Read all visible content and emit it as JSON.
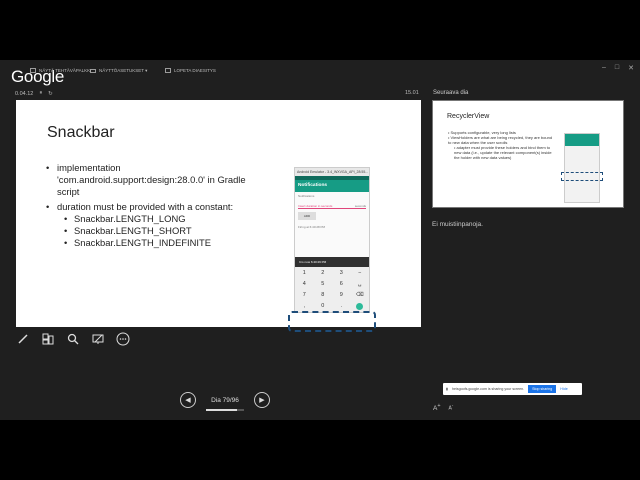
{
  "topbar": {
    "logo": "Google",
    "show_taskbar": "NÄYTÄ TEHTÄVÄPALKKI",
    "display_tools": "NÄYTTÖASETUKSET ▾",
    "end_slideshow": "LOPETA DIAESITYS"
  },
  "timer": {
    "elapsed": "0.04.12",
    "clock": "15.01"
  },
  "slide": {
    "title": "Snackbar",
    "bullet1": "implementation 'com.android.support:design:28.0.0' in Gradle script",
    "bullet2": "duration must be provided with a constant:",
    "sub_bullets": [
      "Snackbar.LENGTH_LONG",
      "Snackbar.LENGTH_SHORT",
      "Snackbar.LENGTH_INDEFINITE"
    ],
    "phone": {
      "window_title": "Android Emulator - 3.4_WXVGA_API_28:55...",
      "app_bar": "Notifications",
      "label": "Notifications",
      "input_placeholder": "Insert duration in seconds",
      "input_suffix": "seconds",
      "button": "ADD",
      "timing": "Firing at 6:40:28 PM",
      "snackbar": "It is now 6:40:29 PM",
      "keys": [
        "1",
        "2",
        "3",
        "−",
        "4",
        "5",
        "6",
        "␣",
        "7",
        "8",
        "9",
        "⌫",
        ",",
        "0",
        ".",
        ""
      ]
    }
  },
  "next": {
    "label": "Seuraava dia",
    "title": "RecyclerView",
    "b1": "Supports configurable, very long lists",
    "b2": "ViewHolders are what are being recycled, they are bound to new data when the user scrolls",
    "b3": "adapter must provide these holders and bind them to new data (i.e., update the relevant component(s) inside the holder with new data values)"
  },
  "notes": "Ei muistiinpanoja.",
  "navigation": {
    "page": "Dia 79/96",
    "progress": 0.82
  },
  "share_banner": {
    "text": "heisgoofs.google.com is sharing your screen.",
    "stop": "Stop sharing",
    "hide": "Hide"
  },
  "font_controls": {
    "increase": "A",
    "decrease": "A"
  }
}
